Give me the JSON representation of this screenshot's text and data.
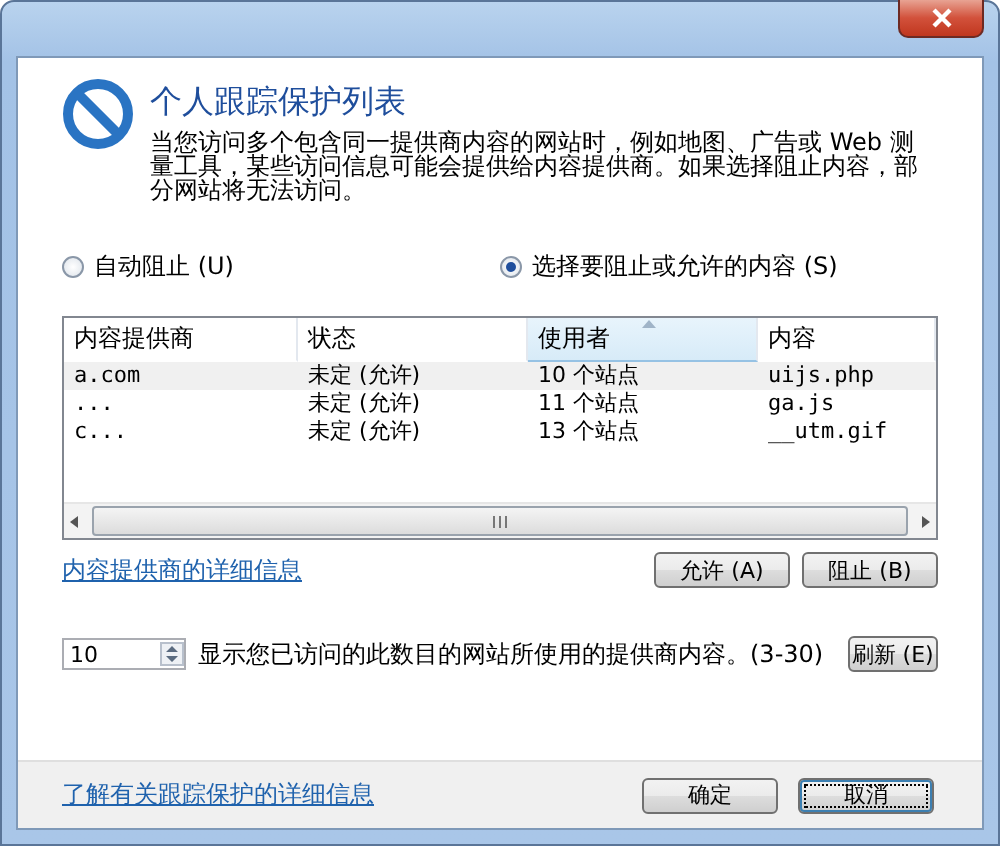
{
  "dialog": {
    "title": "个人跟踪保护列表",
    "description": "当您访问多个包含同一提供商内容的网站时，例如地图、广告或 Web 测量工具，某些访问信息可能会提供给内容提供商。如果选择阻止内容，部分网站将无法访问。"
  },
  "options": [
    {
      "label": "自动阻止 (U)",
      "selected": false
    },
    {
      "label": "选择要阻止或允许的内容 (S)",
      "selected": true
    }
  ],
  "table": {
    "columns": [
      {
        "label": "内容提供商",
        "sorted": false
      },
      {
        "label": "状态",
        "sorted": false
      },
      {
        "label": "使用者",
        "sorted": true
      },
      {
        "label": "内容",
        "sorted": false
      }
    ],
    "rows": [
      {
        "cells": [
          "a.com",
          "未定 (允许)",
          "10 个站点",
          "uijs.php"
        ],
        "selected": true
      },
      {
        "cells": [
          "...",
          "未定 (允许)",
          "11 个站点",
          "ga.js"
        ],
        "selected": false
      },
      {
        "cells": [
          "c...",
          "未定 (允许)",
          "13 个站点",
          "__utm.gif"
        ],
        "selected": false
      }
    ]
  },
  "details_link": "内容提供商的详细信息",
  "action_buttons": [
    {
      "label": "允许 (A)",
      "focused": false
    },
    {
      "label": "阻止 (B)",
      "focused": false
    }
  ],
  "threshold": {
    "value": "10",
    "text": "显示您已访问的此数目的网站所使用的提供商内容。(3-30)",
    "button": "刷新 (E)"
  },
  "footer": {
    "link": "了解有关跟踪保护的详细信息",
    "buttons": [
      {
        "label": "确定",
        "focused": false
      },
      {
        "label": "取消",
        "focused": true
      }
    ]
  }
}
